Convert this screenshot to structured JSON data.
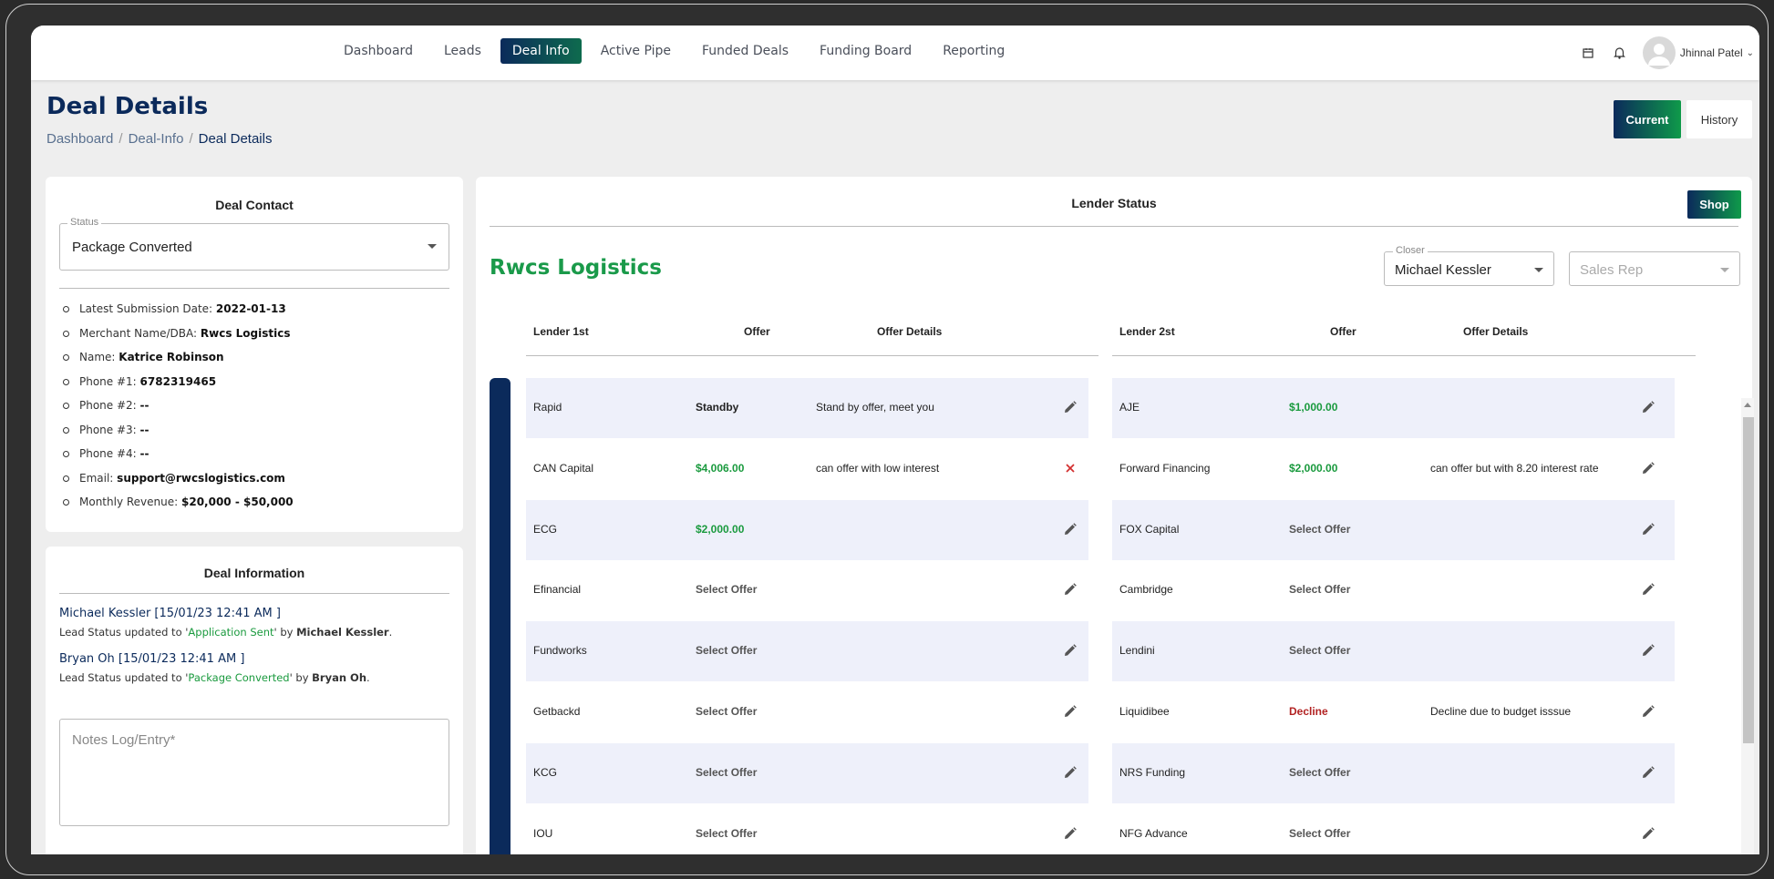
{
  "nav": {
    "links": [
      "Dashboard",
      "Leads",
      "Deal Info",
      "Active Pipe",
      "Funded Deals",
      "Funding Board",
      "Reporting"
    ],
    "user_name": "Jhinnal Patel"
  },
  "header": {
    "title": "Deal Details",
    "breadcrumb": [
      "Dashboard",
      "Deal-Info",
      "Deal Details"
    ],
    "current_label": "Current",
    "history_label": "History"
  },
  "deal_contact": {
    "title": "Deal Contact",
    "status_label": "Status",
    "status_value": "Package Converted",
    "items": [
      {
        "label": "Latest Submission Date:",
        "value": "2022-01-13"
      },
      {
        "label": "Merchant Name/DBA:",
        "value": "Rwcs Logistics"
      },
      {
        "label": "Name:",
        "value": "Katrice Robinson"
      },
      {
        "label": "Phone #1:",
        "value": "6782319465"
      },
      {
        "label": "Phone #2:",
        "value": "--"
      },
      {
        "label": "Phone #3:",
        "value": "--"
      },
      {
        "label": "Phone #4:",
        "value": "--"
      },
      {
        "label": "Email:",
        "value": "support@rwcslogistics.com"
      },
      {
        "label": "Monthly Revenue:",
        "value": "$20,000 - $50,000"
      }
    ]
  },
  "deal_info": {
    "title": "Deal Information",
    "logs": [
      {
        "head": "Michael Kessler [15/01/23 12:41 AM ]",
        "prefix": "Lead Status updated to '",
        "status": "Application Sent",
        "suffix": "' by ",
        "by": "Michael Kessler",
        "end": "."
      },
      {
        "head": "Bryan Oh [15/01/23 12:41 AM ]",
        "prefix": "Lead Status updated to '",
        "status": "Package Converted",
        "suffix": "' by ",
        "by": "Bryan Oh",
        "end": "."
      }
    ],
    "notes_placeholder": "Notes Log/Entry*"
  },
  "lender_status": {
    "title": "Lender Status",
    "shop_label": "Shop",
    "company": "Rwcs Logistics",
    "closer_label": "Closer",
    "closer_value": "Michael Kessler",
    "sales_rep_placeholder": "Sales Rep",
    "headers_1": [
      "Lender 1st",
      "Offer",
      "Offer Details"
    ],
    "headers_2": [
      "Lender 2st",
      "Offer",
      "Offer Details"
    ],
    "rows": [
      {
        "l1": "Rapid",
        "o1": "Standby",
        "o1s": "dark",
        "d1": "Stand by offer, meet you",
        "a1": "edit",
        "l2": "AJE",
        "o2": "$1,000.00",
        "o2s": "green",
        "d2": "",
        "a2": "edit"
      },
      {
        "l1": "CAN Capital",
        "o1": "$4,006.00",
        "o1s": "green",
        "d1": "can offer with low interest",
        "a1": "close",
        "l2": "Forward Financing",
        "o2": "$2,000.00",
        "o2s": "green",
        "d2": "can offer but with 8.20 interest rate",
        "a2": "edit"
      },
      {
        "l1": "ECG",
        "o1": "$2,000.00",
        "o1s": "green",
        "d1": "",
        "a1": "edit",
        "l2": "FOX Capital",
        "o2": "Select Offer",
        "o2s": "grey",
        "d2": "",
        "a2": "edit"
      },
      {
        "l1": "Efinancial",
        "o1": "Select Offer",
        "o1s": "grey",
        "d1": "",
        "a1": "edit",
        "l2": "Cambridge",
        "o2": "Select Offer",
        "o2s": "grey",
        "d2": "",
        "a2": "edit"
      },
      {
        "l1": "Fundworks",
        "o1": "Select Offer",
        "o1s": "grey",
        "d1": "",
        "a1": "edit",
        "l2": "Lendini",
        "o2": "Select Offer",
        "o2s": "grey",
        "d2": "",
        "a2": "edit"
      },
      {
        "l1": "Getbackd",
        "o1": "Select Offer",
        "o1s": "grey",
        "d1": "",
        "a1": "edit",
        "l2": "Liquidibee",
        "o2": "Decline",
        "o2s": "red",
        "d2": "Decline due to budget isssue",
        "a2": "edit"
      },
      {
        "l1": "KCG",
        "o1": "Select Offer",
        "o1s": "grey",
        "d1": "",
        "a1": "edit",
        "l2": "NRS Funding",
        "o2": "Select Offer",
        "o2s": "grey",
        "d2": "",
        "a2": "edit"
      },
      {
        "l1": "IOU",
        "o1": "Select Offer",
        "o1s": "grey",
        "d1": "",
        "a1": "edit",
        "l2": "NFG Advance",
        "o2": "Select Offer",
        "o2s": "grey",
        "d2": "",
        "a2": "edit"
      }
    ]
  },
  "colors": {
    "brand_navy": "#0b2a5b",
    "brand_green": "#1a9a4a",
    "decline_red": "#b22222"
  }
}
